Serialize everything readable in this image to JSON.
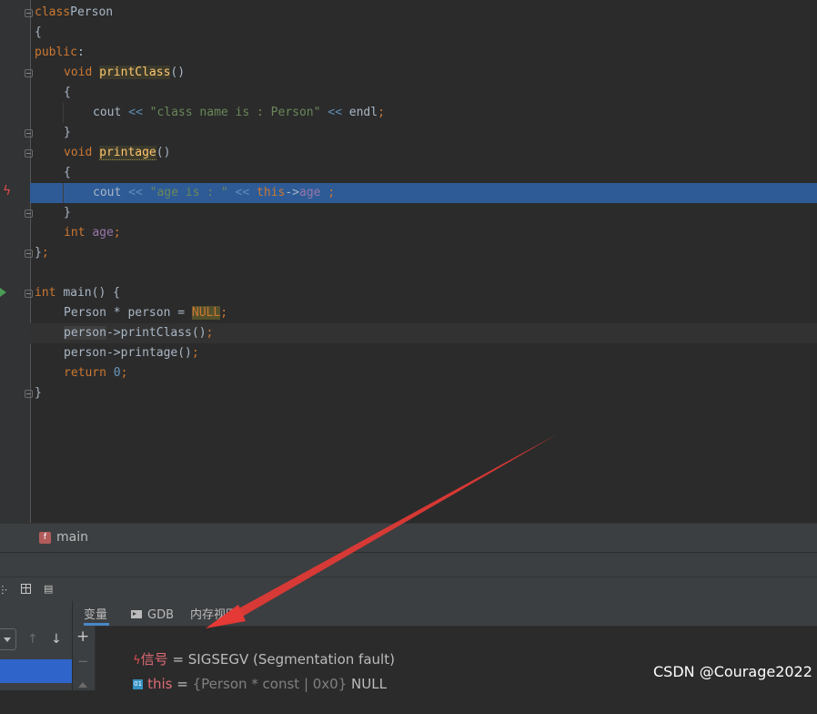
{
  "editor": {
    "lines": [
      {
        "tokens": [
          [
            "kw",
            "class"
          ],
          [
            "",
            "Person"
          ]
        ],
        "indent": 0
      },
      {
        "tokens": [
          [
            "",
            "{"
          ]
        ],
        "indent": 0
      },
      {
        "tokens": [
          [
            "kw",
            "public"
          ],
          [
            "",
            ":"
          ]
        ],
        "indent": 0
      },
      {
        "tokens": [
          [
            "kw",
            "void"
          ],
          [
            "",
            ""
          ],
          [
            "fn-mark",
            "printClass"
          ],
          [
            "",
            "()"
          ]
        ],
        "indent": 1
      },
      {
        "tokens": [
          [
            "",
            "{"
          ]
        ],
        "indent": 1
      },
      {
        "tokens": [
          [
            "",
            "cout "
          ],
          [
            "op",
            "<<"
          ],
          [
            "str",
            " \"class name is : Person\""
          ],
          [
            "op",
            " <<"
          ],
          [
            "",
            ""
          ],
          [
            "",
            "endl"
          ],
          [
            "kw",
            ";"
          ]
        ],
        "indent": 2
      },
      {
        "tokens": [
          [
            "",
            "}"
          ]
        ],
        "indent": 1
      },
      {
        "tokens": [
          [
            "kw",
            "void"
          ],
          [
            "",
            ""
          ],
          [
            "fn-mark2",
            "printage"
          ],
          [
            "",
            "()"
          ]
        ],
        "indent": 1
      },
      {
        "tokens": [
          [
            "",
            "{"
          ]
        ],
        "indent": 1
      },
      {
        "tokens": [
          [
            "",
            "cout "
          ],
          [
            "op",
            "<<"
          ],
          [
            "str",
            " \"age is : \""
          ],
          [
            "op",
            " <<"
          ],
          [
            "",
            ""
          ],
          [
            "kw",
            "this"
          ],
          [
            "",
            "->"
          ],
          [
            "field",
            "age"
          ],
          [
            "kw",
            " ;"
          ]
        ],
        "indent": 2
      },
      {
        "tokens": [
          [
            "",
            "}"
          ]
        ],
        "indent": 1
      },
      {
        "tokens": [
          [
            "kw",
            "int"
          ],
          [
            "",
            ""
          ],
          [
            "field",
            "age"
          ],
          [
            "kw",
            ";"
          ]
        ],
        "indent": 1
      },
      {
        "tokens": [
          [
            "",
            "}"
          ],
          [
            "kw",
            ";"
          ]
        ],
        "indent": 0
      },
      {
        "tokens": [],
        "indent": 0
      },
      {
        "tokens": [
          [
            "kw",
            "int"
          ],
          [
            "",
            ""
          ],
          [
            "",
            "main"
          ],
          [
            "",
            "() {"
          ]
        ],
        "indent": 0
      },
      {
        "tokens": [
          [
            "",
            "Person * person = "
          ],
          [
            "null-mark",
            "NULL"
          ],
          [
            "kw",
            ";"
          ]
        ],
        "indent": 1
      },
      {
        "tokens": [
          [
            "person-mark",
            "person"
          ],
          [
            "",
            "->printClass()"
          ],
          [
            "kw",
            ";"
          ]
        ],
        "indent": 1
      },
      {
        "tokens": [
          [
            "",
            "person->printage()"
          ],
          [
            "kw",
            ";"
          ]
        ],
        "indent": 1
      },
      {
        "tokens": [
          [
            "kw",
            "return"
          ],
          [
            "",
            ""
          ],
          [
            "num",
            "0"
          ],
          [
            "kw",
            ";"
          ]
        ],
        "indent": 1
      },
      {
        "tokens": [
          [
            "",
            "}"
          ]
        ],
        "indent": 0
      }
    ],
    "highlighted_line_number": 10,
    "caret_line_number": 17
  },
  "breadcrumb": {
    "icon_letter": "f",
    "label": "main"
  },
  "debugger": {
    "tabs": [
      {
        "label": "变量",
        "active": true
      },
      {
        "label": "GDB",
        "active": false
      },
      {
        "label": "内存视图",
        "active": false
      }
    ],
    "variables": [
      {
        "icon": "lightning-icon",
        "name": "信号",
        "eq": " = ",
        "type": "",
        "value": "SIGSEGV (Segmentation fault)"
      },
      {
        "icon": "01",
        "name": "this",
        "eq": " = ",
        "type": "{Person * const | 0x0}",
        "value": " NULL"
      }
    ]
  },
  "watermark": "CSDN @Courage2022",
  "colors": {
    "highlight": "#2e5b96",
    "annotation_arrow": "#e53935",
    "frame_selection": "#2f65ca"
  }
}
